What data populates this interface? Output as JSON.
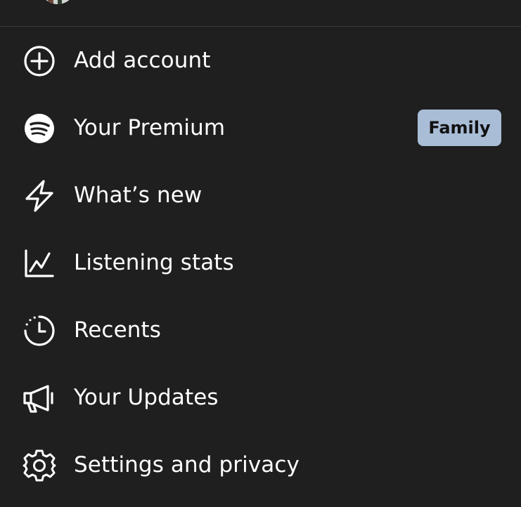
{
  "menu": {
    "items": [
      {
        "label": "Add account",
        "icon": "plus-circle-icon"
      },
      {
        "label": "Your Premium",
        "icon": "spotify-icon",
        "badge": "Family"
      },
      {
        "label": "What’s new",
        "icon": "lightning-icon"
      },
      {
        "label": "Listening stats",
        "icon": "line-chart-icon"
      },
      {
        "label": "Recents",
        "icon": "clock-history-icon"
      },
      {
        "label": "Your Updates",
        "icon": "megaphone-icon"
      },
      {
        "label": "Settings and privacy",
        "icon": "gear-icon"
      }
    ]
  },
  "colors": {
    "background": "#1f1f1f",
    "divider": "#3a3a3a",
    "text": "#ffffff",
    "badge_bg": "#a9bdd7",
    "badge_text": "#111111"
  }
}
